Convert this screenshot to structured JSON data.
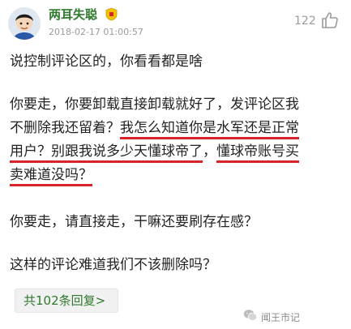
{
  "comment": {
    "username": "两耳失聪",
    "timestamp": "2018-02-17 01:00:57",
    "like_count": "122",
    "icons": {
      "avatar": "cartoon-avatar",
      "badge": "club-badge-icon",
      "like": "thumbs-up-icon"
    },
    "paragraph1": "说控制评论区的，你看看都是啥",
    "paragraph2": {
      "line1": "你要走，你要卸载直接卸载就好了，发评论区我",
      "line2_plain": "不删除我还留着？",
      "line2_underlined": "我怎么知道你是水军还是正常",
      "line3_underlined_a": "用户？别跟我说多少天懂球帝了",
      "line3_plain": "，",
      "line3_underlined_b": "懂球帝账号买",
      "line4_underlined": "卖难道没吗？"
    },
    "paragraph3": "你要走，请直接走，干嘛还要刷存在感？",
    "paragraph4": "这样的评论难道我们不该删除吗？",
    "reply_button_label": "共102条回复>",
    "colors": {
      "username": "#2f7a2f",
      "underline": "#d9232b",
      "meta": "#9a9a9a"
    }
  },
  "watermark": {
    "text": "闻王市记",
    "icon": "wechat-icon"
  }
}
